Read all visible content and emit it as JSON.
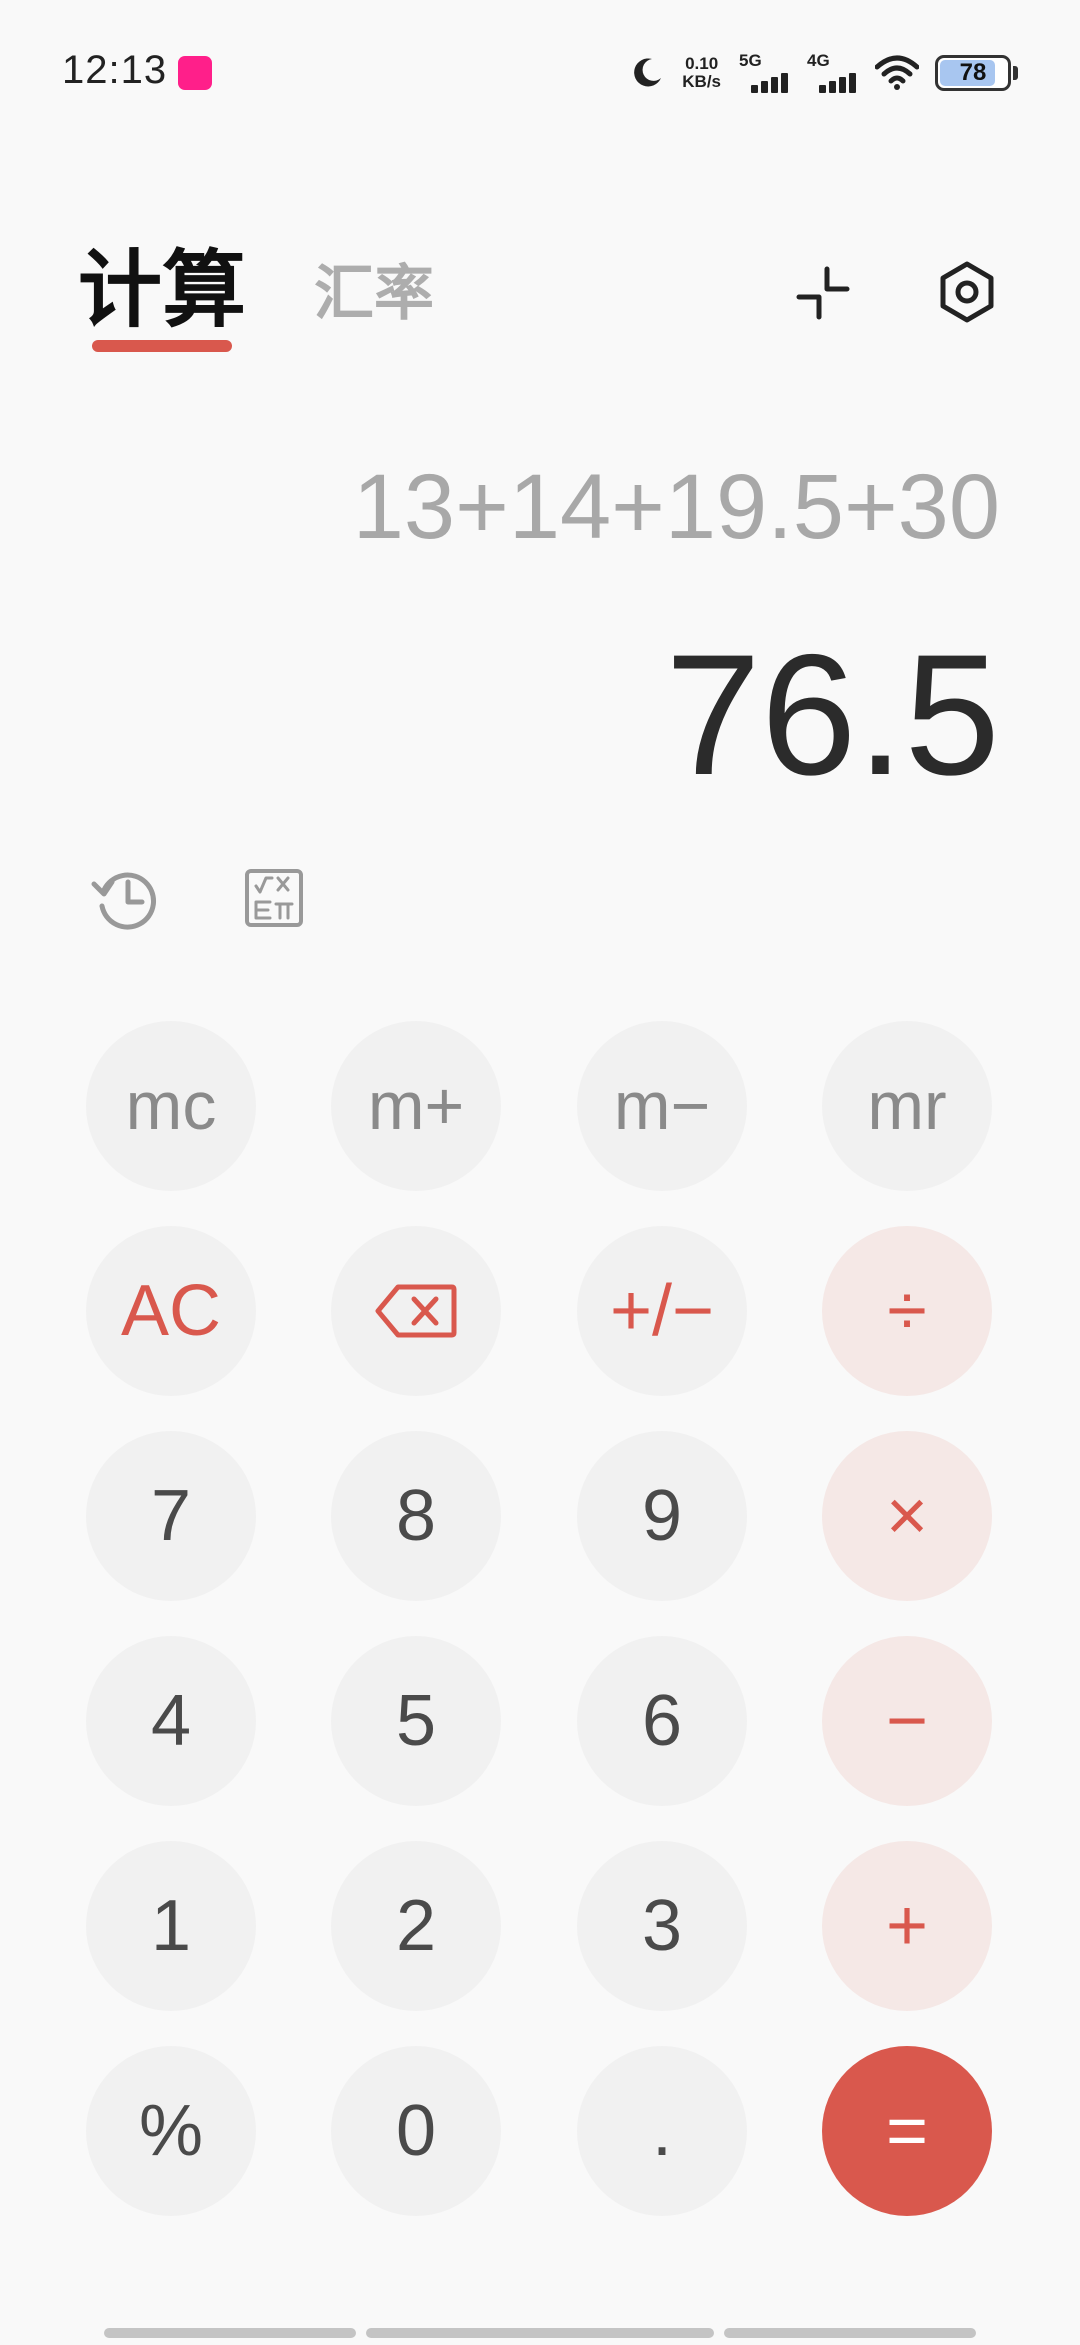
{
  "status_bar": {
    "time": "12:13",
    "netspeed_value": "0.10",
    "netspeed_unit": "KB/s",
    "sim1_label": "5G",
    "sim2_label": "4G",
    "battery_level": "78"
  },
  "tabs": {
    "calculator": "计算",
    "exchange_rate": "汇率"
  },
  "display": {
    "expression": "13+14+19.5+30",
    "result": "76.5"
  },
  "keypad": {
    "mc": "mc",
    "mplus": "m+",
    "mminus": "m−",
    "mr": "mr",
    "ac": "AC",
    "plusminus": "+/−",
    "divide": "÷",
    "seven": "7",
    "eight": "8",
    "nine": "9",
    "multiply": "×",
    "four": "4",
    "five": "5",
    "six": "6",
    "minus": "−",
    "one": "1",
    "two": "2",
    "three": "3",
    "plus": "+",
    "percent": "%",
    "zero": "0",
    "dot": ".",
    "equals": "="
  },
  "colors": {
    "accent": "#d9584d",
    "operator_bg": "#f5e8e6",
    "key_bg": "#f1f1f1",
    "background": "#f9f9f9"
  },
  "icons": {
    "backspace": "backspace-icon",
    "history": "history-icon",
    "scientific": "scientific-icon",
    "shrink": "shrink-icon",
    "settings": "settings-icon"
  }
}
